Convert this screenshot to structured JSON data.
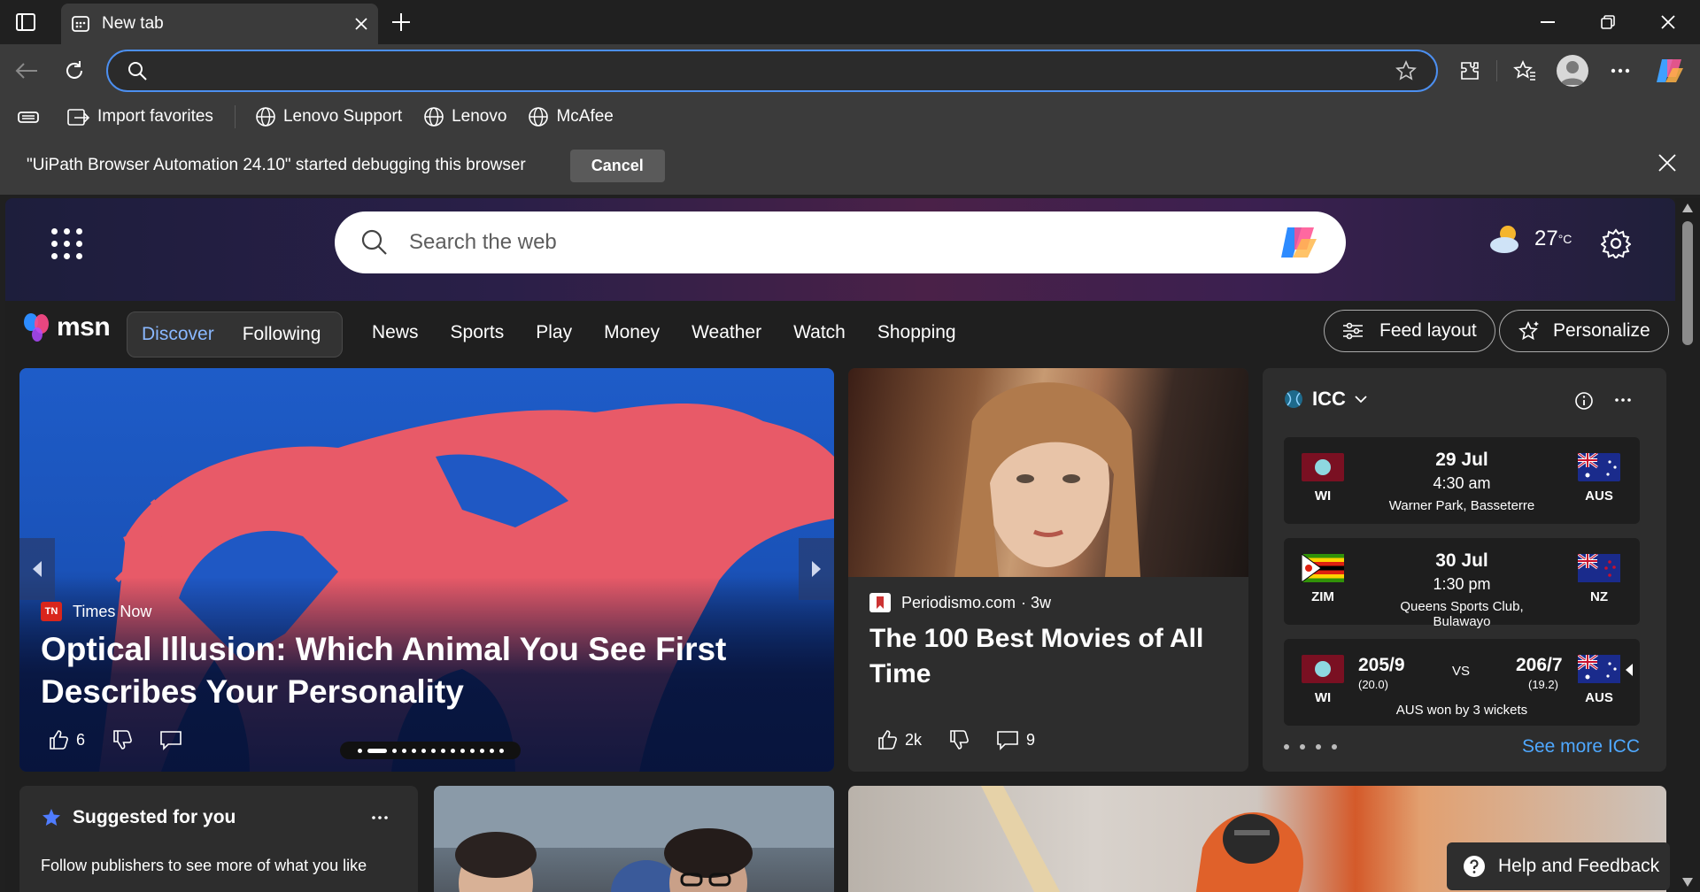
{
  "tab": {
    "title": "New tab"
  },
  "omnibox": {
    "value": "",
    "placeholder": ""
  },
  "favorites": [
    {
      "label": "Import favorites",
      "icon": "import-favorites-icon"
    },
    {
      "label": "Lenovo Support",
      "icon": "globe-icon"
    },
    {
      "label": "Lenovo",
      "icon": "globe-icon"
    },
    {
      "label": "McAfee",
      "icon": "globe-icon"
    }
  ],
  "infobar": {
    "message": "\"UiPath Browser Automation 24.10\" started debugging this browser",
    "cancel_label": "Cancel"
  },
  "msn": {
    "search_placeholder": "Search the web",
    "temperature": "27",
    "temp_unit": "°C",
    "logo_text": "msn",
    "tabs": [
      "Discover",
      "Following"
    ],
    "nav": [
      "News",
      "Sports",
      "Play",
      "Money",
      "Weather",
      "Watch",
      "Shopping"
    ],
    "feed_layout_label": "Feed layout",
    "personalize_label": "Personalize"
  },
  "hero": {
    "source": "Times Now",
    "source_logo": "TN",
    "title": "Optical Illusion: Which Animal You See First Describes Your Personality",
    "likes": "6"
  },
  "movie": {
    "source": "Periodismo.com",
    "age": "· 3w",
    "title": "The 100 Best Movies of All Time",
    "likes": "2k",
    "comments": "9"
  },
  "icc": {
    "title": "ICC",
    "see_more": "See more ICC",
    "matches": [
      {
        "team1": "WI",
        "team2": "AUS",
        "date": "29 Jul",
        "time": "4:30 am",
        "venue": "Warner Park, Basseterre"
      },
      {
        "team1": "ZIM",
        "team2": "NZ",
        "date": "30 Jul",
        "time": "1:30 pm",
        "venue": "Queens Sports Club, Bulawayo"
      }
    ],
    "result": {
      "team1": "WI",
      "team2": "AUS",
      "score1": "205/9",
      "overs1": "(20.0)",
      "score2": "206/7",
      "overs2": "(19.2)",
      "vs": "VS",
      "result": "AUS won by 3 wickets"
    }
  },
  "suggested": {
    "title": "Suggested for you",
    "text": "Follow publishers to see more of what you like"
  },
  "help": {
    "label": "Help and Feedback"
  },
  "colors": {
    "accent": "#4c8ff0",
    "link": "#4fa8ff",
    "active_tab": "#8ab8ff"
  }
}
